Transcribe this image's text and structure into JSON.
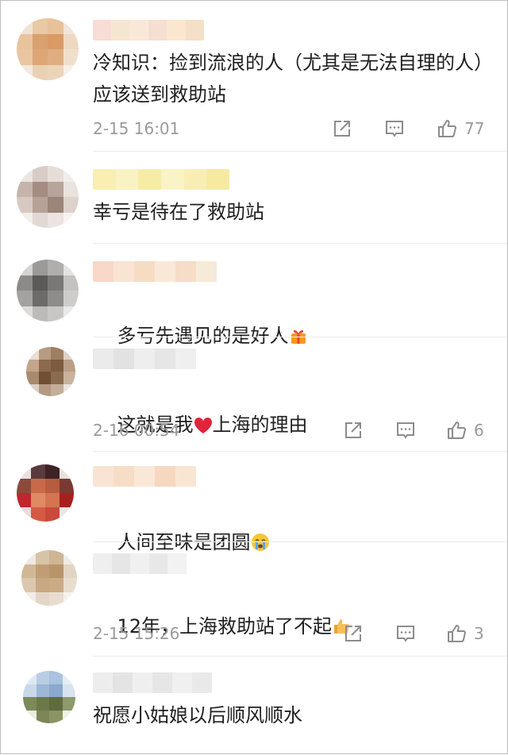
{
  "comments": [
    {
      "text": "冷知识：捡到流浪的人（尤其是无法自理的人）应该送到救助站",
      "time": "2-15 16:01",
      "likes": "77",
      "icons": [
        "share-icon",
        "comment-icon",
        "thumbs-up-icon"
      ]
    },
    {
      "text": "幸亏是待在了救助站"
    },
    {
      "text": "多亏先遇见的是好人",
      "emoji": "gift-icon"
    },
    {
      "text_before": "这就是我",
      "text_after": "上海的理由",
      "emoji": "heart-icon",
      "time": "2-16 00:54",
      "likes": "6"
    },
    {
      "text": "人间至味是团圆",
      "emoji": "crying-face-icon"
    },
    {
      "text": "12年，上海救助站了不起",
      "emoji": "thumbs-up-emoji",
      "time": "2-15 15:26",
      "likes": "3"
    },
    {
      "text": "祝愿小姑娘以后顺风顺水"
    }
  ],
  "colors": {
    "text": "#1f1f1f",
    "meta": "#9a9a9a",
    "icon": "#8c8c8c",
    "heart": "#e0243b"
  }
}
